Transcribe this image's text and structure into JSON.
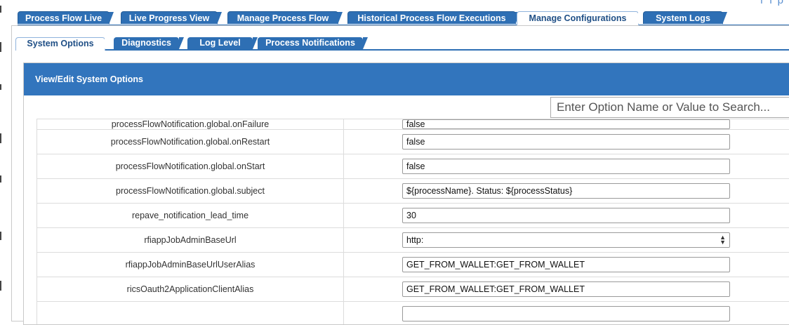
{
  "corner": {
    "text": "т т р т"
  },
  "top_tabs": [
    {
      "label": "Process Flow Live",
      "active": false
    },
    {
      "label": "Live Progress View",
      "active": false
    },
    {
      "label": "Manage Process Flow",
      "active": false
    },
    {
      "label": "Historical Process Flow Executions",
      "active": false
    },
    {
      "label": "Manage Configurations",
      "active": true
    },
    {
      "label": "System Logs",
      "active": false
    }
  ],
  "sub_tabs": [
    {
      "label": "System Options",
      "active": true
    },
    {
      "label": "Diagnostics",
      "active": false
    },
    {
      "label": "Log Level",
      "active": false
    },
    {
      "label": "Process Notifications",
      "active": false
    }
  ],
  "panel": {
    "title": "View/Edit System Options",
    "search_placeholder": "Enter Option Name or Value to Search..."
  },
  "rows": [
    {
      "name": "processFlowNotification.global.onFailure",
      "value": "false"
    },
    {
      "name": "processFlowNotification.global.onRestart",
      "value": "false"
    },
    {
      "name": "processFlowNotification.global.onStart",
      "value": "false"
    },
    {
      "name": "processFlowNotification.global.subject",
      "value": "${processName}. Status: ${processStatus}"
    },
    {
      "name": "repave_notification_lead_time",
      "value": "30"
    },
    {
      "name": "rfiappJobAdminBaseUrl",
      "value": "http:"
    },
    {
      "name": "rfiappJobAdminBaseUrlUserAlias",
      "value": "GET_FROM_WALLET:GET_FROM_WALLET"
    },
    {
      "name": "ricsOauth2ApplicationClientAlias",
      "value": "GET_FROM_WALLET:GET_FROM_WALLET"
    },
    {
      "name": "",
      "value": ""
    }
  ]
}
